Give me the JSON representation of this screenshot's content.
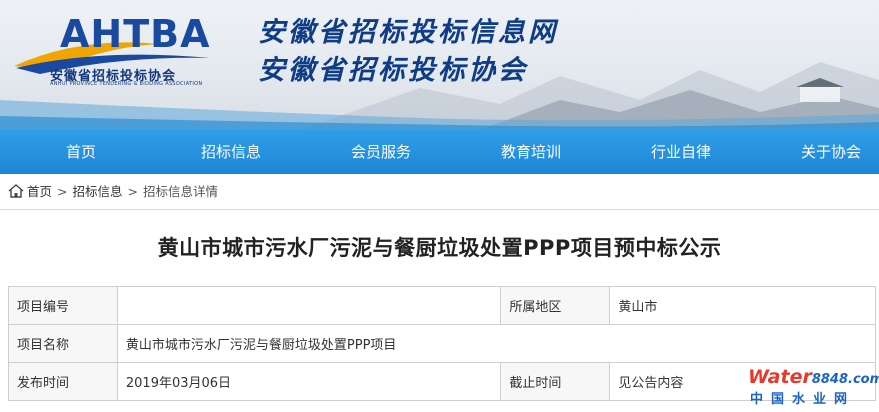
{
  "header": {
    "logo_text": "AHTBA",
    "logo_cn": "安徽省招标投标协会",
    "logo_en": "ANHUI PROVINCE TENDERING & BIDDING ASSOCIATION",
    "title_line1": "安徽省招标投标信息网",
    "title_line2": "安徽省招标投标协会"
  },
  "nav": {
    "items": [
      {
        "label": "首页"
      },
      {
        "label": "招标信息"
      },
      {
        "label": "会员服务"
      },
      {
        "label": "教育培训"
      },
      {
        "label": "行业自律"
      },
      {
        "label": "关于协会"
      }
    ]
  },
  "breadcrumb": {
    "home": "首页",
    "section": "招标信息",
    "current": "招标信息详情",
    "separator": ">"
  },
  "article": {
    "title": "黄山市城市污水厂污泥与餐厨垃圾处置PPP项目预中标公示"
  },
  "info": {
    "project_no_label": "项目编号",
    "project_no_value": "",
    "region_label": "所属地区",
    "region_value": "黄山市",
    "project_name_label": "项目名称",
    "project_name_value": "黄山市城市污水厂污泥与餐厨垃圾处置PPP项目",
    "publish_label": "发布时间",
    "publish_value": "2019年03月06日",
    "deadline_label": "截止时间",
    "deadline_value": "见公告内容"
  },
  "watermark": {
    "brand_a": "Water",
    "brand_b": "8848.com",
    "brand_cn": "中国水业网"
  },
  "colors": {
    "nav_bg": "#1f86d6",
    "title_blue": "#0f3c86",
    "logo_blue": "#1a4aa0"
  }
}
